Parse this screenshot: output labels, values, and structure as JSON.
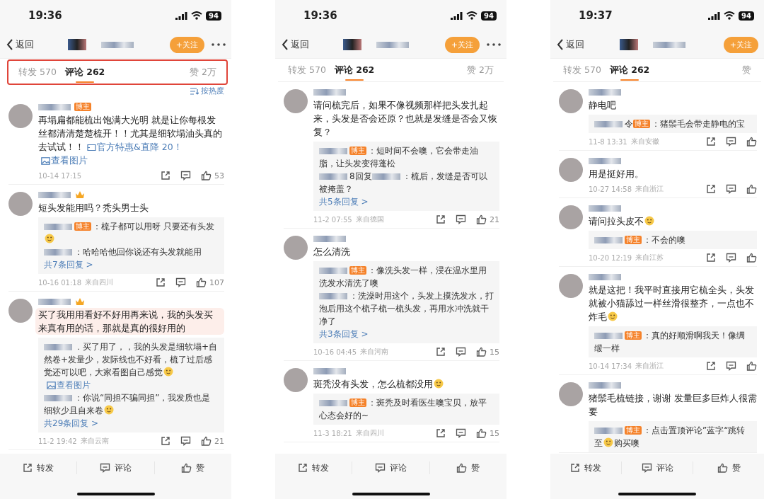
{
  "phones": [
    {
      "time": "19:36",
      "battery": "94",
      "more_menu": true,
      "back": "返回",
      "follow": "+关注",
      "tabs_highlighted": true,
      "tabs": [
        {
          "label": "转发 570",
          "selected": false
        },
        {
          "label": "评论 262",
          "selected": true
        },
        {
          "label": "赞 2万",
          "selected": false
        }
      ],
      "sort": "按热度",
      "comments": [
        {
          "author": [
            {
              "kind": "blur"
            },
            {
              "kind": "badge",
              "text": "博主"
            }
          ],
          "highlighted": false,
          "text": [
            {
              "kind": "text",
              "text": "再塌扁都能梳出饱满大光明 就是让你每根发丝都清清楚楚梳开！！尤其是细软塌油头真的去试试！！"
            },
            {
              "kind": "offer_link",
              "text": "官方特惠&直降 20！"
            },
            {
              "kind": "image_link",
              "text": "查看图片"
            }
          ],
          "time": "10-14 17:15",
          "likes": "53"
        },
        {
          "author": [
            {
              "kind": "blur"
            },
            {
              "kind": "crown"
            }
          ],
          "highlighted": false,
          "text": [
            {
              "kind": "text",
              "text": "短头发能用吗？秃头男士头"
            }
          ],
          "replies": [
            [
              {
                "kind": "blur"
              },
              {
                "kind": "badge",
                "text": "博主"
              },
              {
                "kind": "text",
                "text": "：梳子都可以用呀 只要还有头发"
              },
              {
                "kind": "emoji"
              }
            ],
            [
              {
                "kind": "blur"
              },
              {
                "kind": "text",
                "text": "：哈哈哈他回你说还有头发就能用"
              }
            ]
          ],
          "more": "共7条回复 >",
          "time": "10-16 01:18",
          "location": "来自四川",
          "likes": "107"
        },
        {
          "author": [
            {
              "kind": "blur"
            },
            {
              "kind": "crown"
            }
          ],
          "highlighted": true,
          "text": [
            {
              "kind": "text",
              "text": "买了我用用看好不好用再来说，我的头发买来真有用的话，那就是真的很好用的"
            }
          ],
          "replies": [
            [
              {
                "kind": "blur"
              },
              {
                "kind": "text",
                "text": "．买了用了，，我的头发是细软塌+自然卷+发量少，发际线也不好看，梳了过后感觉还可以吧，大家看图自己感觉"
              },
              {
                "kind": "emoji"
              },
              {
                "kind": "image_link",
                "text": "查看图片"
              }
            ],
            [
              {
                "kind": "blur"
              },
              {
                "kind": "text",
                "text": "：你说“同担不骗同担”，我发质也是细软少且自来卷"
              },
              {
                "kind": "emoji"
              }
            ]
          ],
          "more": "共29条回复 >",
          "time": "11-2 19:42",
          "location": "来自云南",
          "likes": "21"
        }
      ],
      "actions": [
        "转发",
        "评论",
        "赞"
      ]
    },
    {
      "time": "19:36",
      "battery": "94",
      "more_menu": true,
      "back": "返回",
      "follow": "+关注",
      "tabs_highlighted": false,
      "tabs": [
        {
          "label": "转发 570",
          "selected": false
        },
        {
          "label": "评论 262",
          "selected": true
        },
        {
          "label": "赞 2万",
          "selected": false
        }
      ],
      "comments": [
        {
          "author": [
            {
              "kind": "blur"
            }
          ],
          "highlighted": false,
          "text": [
            {
              "kind": "text",
              "text": "请问梳完后，如果不像视频那样把头发扎起来，头发是否会还原？也就是发缝是否会又恢复？"
            }
          ],
          "replies": [
            [
              {
                "kind": "blur"
              },
              {
                "kind": "badge",
                "text": "博主"
              },
              {
                "kind": "text",
                "text": "：短时间不会噢，它会带走油脂，让头发变得蓬松"
              }
            ],
            [
              {
                "kind": "blur"
              },
              {
                "kind": "text",
                "text": "8回复"
              },
              {
                "kind": "blur"
              },
              {
                "kind": "text",
                "text": "：梳后，发缝是否可以被掩盖？"
              }
            ]
          ],
          "more": "共5条回复 >",
          "time": "11-2 07:55",
          "location": "来自德国",
          "likes": "21"
        },
        {
          "author": [
            {
              "kind": "blur"
            }
          ],
          "highlighted": false,
          "text": [
            {
              "kind": "text",
              "text": "怎么清洗"
            }
          ],
          "replies": [
            [
              {
                "kind": "blur"
              },
              {
                "kind": "badge",
                "text": "博主"
              },
              {
                "kind": "text",
                "text": "：像洗头发一样，浸在温水里用洗发水清洗了噢"
              }
            ],
            [
              {
                "kind": "blur"
              },
              {
                "kind": "text",
                "text": "：洗澡时用这个，头发上摸洗发水，打泡后用这个梳子梳一梳头发，再用水冲洗就干净了"
              }
            ]
          ],
          "more": "共3条回复 >",
          "time": "10-16 04:45",
          "location": "来自河南",
          "likes": "15"
        },
        {
          "author": [
            {
              "kind": "blur"
            }
          ],
          "highlighted": false,
          "text": [
            {
              "kind": "text",
              "text": "斑秃没有头发，怎么梳都没用"
            },
            {
              "kind": "emoji"
            }
          ],
          "replies": [
            [
              {
                "kind": "blur"
              },
              {
                "kind": "badge",
                "text": "博主"
              },
              {
                "kind": "text",
                "text": "：斑秃及时看医生噢宝贝，放平心态会好的~"
              }
            ]
          ],
          "time": "11-3 18:21",
          "location": "来自四川",
          "likes": "15"
        }
      ],
      "actions": [
        "转发",
        "评论",
        "赞"
      ]
    },
    {
      "time": "19:37",
      "battery": "94",
      "more_menu": false,
      "back": "返回",
      "follow": "+关注",
      "tabs_highlighted": false,
      "tabs": [
        {
          "label": "转发 570",
          "selected": false
        },
        {
          "label": "评论 262",
          "selected": true
        },
        {
          "label": "赞",
          "selected": false
        }
      ],
      "comments": [
        {
          "author": [
            {
              "kind": "blur"
            }
          ],
          "highlighted": false,
          "text": [
            {
              "kind": "text",
              "text": "静电吧"
            }
          ],
          "replies": [
            [
              {
                "kind": "blur"
              },
              {
                "kind": "text",
                "text": "令"
              },
              {
                "kind": "badge",
                "text": "博主"
              },
              {
                "kind": "text",
                "text": "：猪鬃毛会带走静电的宝"
              }
            ]
          ],
          "time": "11-8 13:31",
          "location": "来自安徽"
        },
        {
          "author": [
            {
              "kind": "blur"
            }
          ],
          "highlighted": false,
          "text": [
            {
              "kind": "text",
              "text": "用是挺好用。"
            }
          ],
          "time": "10-27 14:58",
          "location": "来自浙江"
        },
        {
          "author": [
            {
              "kind": "blur"
            }
          ],
          "highlighted": false,
          "text": [
            {
              "kind": "text",
              "text": "请问拉头皮不"
            },
            {
              "kind": "emoji"
            }
          ],
          "replies": [
            [
              {
                "kind": "blur"
              },
              {
                "kind": "badge",
                "text": "博主"
              },
              {
                "kind": "text",
                "text": "：不会的噢"
              }
            ]
          ],
          "time": "10-20 12:19",
          "location": "来自江苏"
        },
        {
          "author": [
            {
              "kind": "blur"
            }
          ],
          "highlighted": false,
          "text": [
            {
              "kind": "text",
              "text": "就是这把！我平时直接用它梳全头，头发就被小猫舔过一样丝滑很整齐，一点也不炸毛"
            },
            {
              "kind": "emoji"
            }
          ],
          "replies": [
            [
              {
                "kind": "blur"
              },
              {
                "kind": "badge",
                "text": "博主"
              },
              {
                "kind": "text",
                "text": "：真的好顺滑啊我天！像绸缎一样"
              }
            ]
          ],
          "time": "10-14 17:34",
          "location": "来自浙江"
        },
        {
          "author": [
            {
              "kind": "blur"
            }
          ],
          "highlighted": false,
          "text": [
            {
              "kind": "text",
              "text": "猪鬃毛梳链接，谢谢 发量巨多巨炸人很需要"
            }
          ],
          "replies": [
            [
              {
                "kind": "blur"
              },
              {
                "kind": "badge",
                "text": "博主"
              },
              {
                "kind": "text",
                "text": "：点击置顶评论”蓝字“跳转至"
              },
              {
                "kind": "emoji"
              },
              {
                "kind": "text",
                "text": "购买噢"
              }
            ]
          ]
        }
      ],
      "actions": [
        "转发",
        "评论",
        "赞"
      ]
    }
  ]
}
